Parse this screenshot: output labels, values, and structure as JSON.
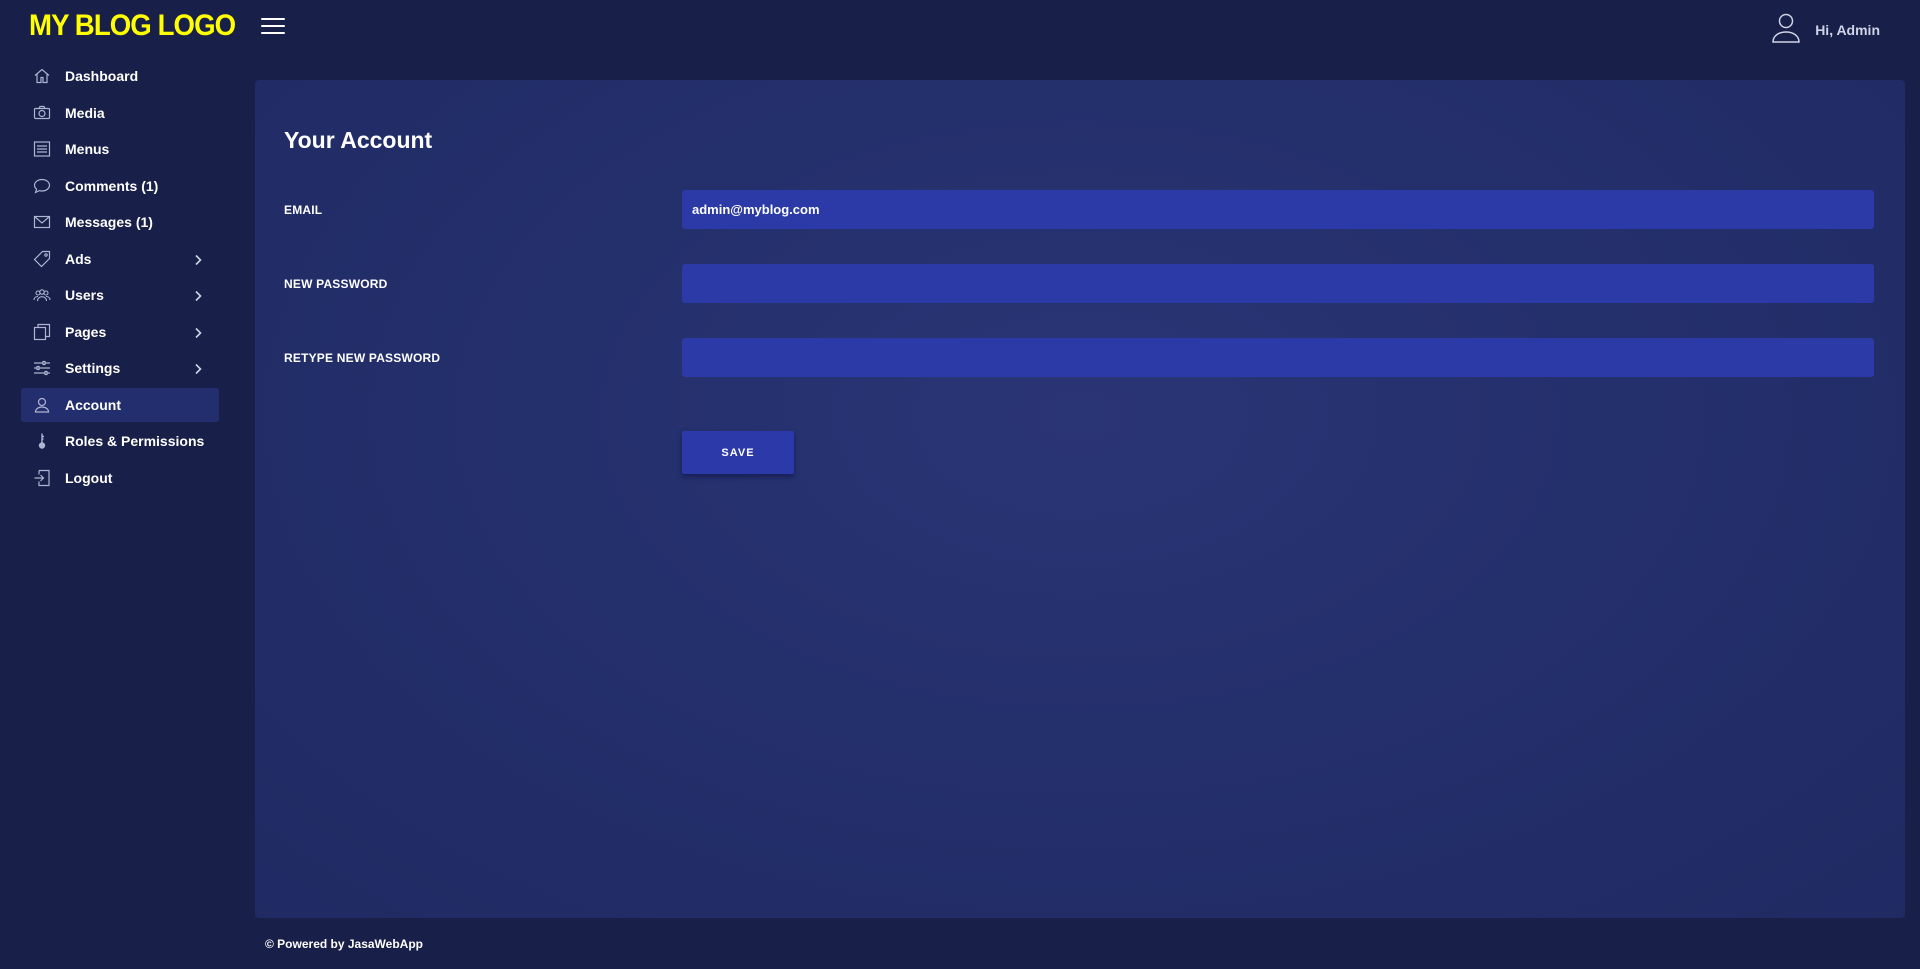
{
  "brand": {
    "logo_text": "MY BLOG LOGO",
    "logo_color": "#ffff00"
  },
  "header": {
    "menu_icon": "hamburger-icon",
    "user_icon": "user-icon",
    "greeting": "Hi, Admin"
  },
  "sidebar": {
    "items": [
      {
        "label": "Dashboard",
        "icon": "home-icon",
        "has_submenu": false,
        "active": false
      },
      {
        "label": "Media",
        "icon": "camera-icon",
        "has_submenu": false,
        "active": false
      },
      {
        "label": "Menus",
        "icon": "list-icon",
        "has_submenu": false,
        "active": false
      },
      {
        "label": "Comments (1)",
        "icon": "comment-icon",
        "has_submenu": false,
        "active": false
      },
      {
        "label": "Messages (1)",
        "icon": "envelope-icon",
        "has_submenu": false,
        "active": false
      },
      {
        "label": "Ads",
        "icon": "tag-icon",
        "has_submenu": true,
        "active": false
      },
      {
        "label": "Users",
        "icon": "users-icon",
        "has_submenu": true,
        "active": false
      },
      {
        "label": "Pages",
        "icon": "pages-icon",
        "has_submenu": true,
        "active": false
      },
      {
        "label": "Settings",
        "icon": "sliders-icon",
        "has_submenu": true,
        "active": false
      },
      {
        "label": "Account",
        "icon": "user-icon",
        "has_submenu": false,
        "active": true
      },
      {
        "label": "Roles & Permissions",
        "icon": "key-icon",
        "has_submenu": false,
        "active": false
      },
      {
        "label": "Logout",
        "icon": "logout-icon",
        "has_submenu": false,
        "active": false
      }
    ]
  },
  "main": {
    "title": "Your Account",
    "form": {
      "email_label": "EMAIL",
      "email_value": "admin@myblog.com",
      "new_password_label": "NEW PASSWORD",
      "new_password_value": "",
      "retype_password_label": "RETYPE NEW PASSWORD",
      "retype_password_value": "",
      "save_label": "SAVE"
    }
  },
  "footer": {
    "text": "© Powered by JasaWebApp"
  },
  "colors": {
    "background": "#181f48",
    "card": "#24306c",
    "input": "#2b3aa6",
    "active_item": "#232e6e",
    "icon_stroke": "#aeb4d2"
  }
}
